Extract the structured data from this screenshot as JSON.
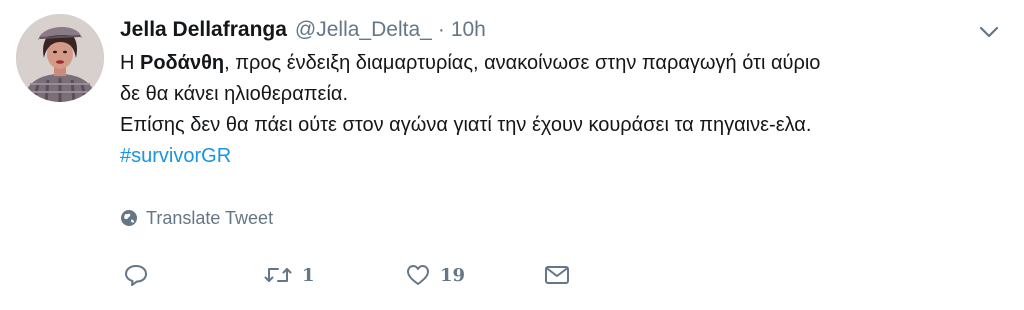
{
  "tweet": {
    "author_name": "Jella Dellafranga",
    "handle": "@Jella_Delta_",
    "separator": "·",
    "time": "10h",
    "text": {
      "line1_prefix": "Η ",
      "line1_bold": "Ροδάνθη",
      "line1_suffix": ", προς ένδειξη διαμαρτυρίας, ανακοίνωσε στην παραγωγή ότι αύριο",
      "line2": "δε θα κάνει ηλιοθεραπεία.",
      "line3": "Επίσης δεν θα πάει ούτε στον αγώνα γιατί την έχουν κουράσει τα πηγαινε-ελα.",
      "hashtag": "#survivorGR"
    },
    "translate_label": "Translate Tweet",
    "actions": {
      "reply_count": "",
      "retweet_count": "1",
      "like_count": "19"
    }
  },
  "icons": {
    "caret": "chevron-down-icon",
    "translate": "globe-icon",
    "reply": "reply-icon",
    "retweet": "retweet-icon",
    "like": "heart-icon",
    "dm": "envelope-icon"
  },
  "colors": {
    "text": "#14171a",
    "secondary": "#657786",
    "link": "#1b95e0",
    "background": "#ffffff"
  }
}
